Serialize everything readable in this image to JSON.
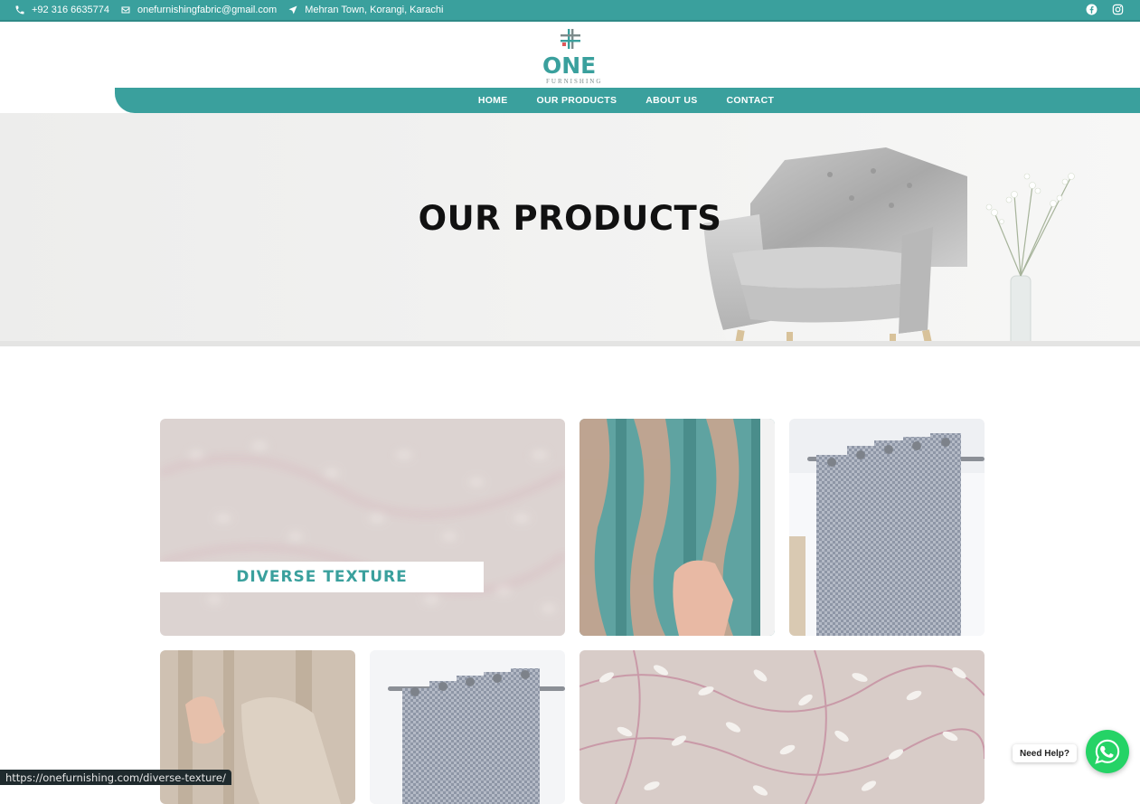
{
  "topbar": {
    "phone": "+92 316 6635774",
    "email": "onefurnishingfabric@gmail.com",
    "address": "Mehran Town, Korangi, Karachi",
    "icons": [
      "phone-icon",
      "email-icon",
      "location-icon",
      "facebook-icon",
      "instagram-icon"
    ]
  },
  "logo": {
    "word": "ONE",
    "sub": "FURNISHING"
  },
  "nav": {
    "items": [
      {
        "label": "HOME"
      },
      {
        "label": "OUR PRODUCTS"
      },
      {
        "label": "ABOUT US"
      },
      {
        "label": "CONTACT"
      }
    ]
  },
  "hero": {
    "title": "OUR PRODUCTS"
  },
  "products": {
    "hovered_label": "DIVERSE TEXTURE"
  },
  "help": {
    "label": "Need Help?"
  },
  "status_bar": {
    "url": "https://onefurnishing.com/diverse-texture/"
  },
  "colors": {
    "brand": "#3aa09d",
    "whatsapp": "#25d366"
  }
}
